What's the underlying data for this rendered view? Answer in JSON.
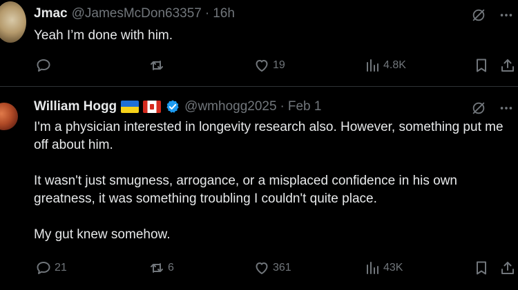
{
  "tweets": [
    {
      "name": "Jmac",
      "handle": "@JamesMcDon63357",
      "separator": "·",
      "time": "16h",
      "text": [
        "Yeah I’m done with him."
      ],
      "replies": "",
      "reposts": "",
      "likes": "19",
      "views": "4.8K"
    },
    {
      "name": "William Hogg",
      "flags": [
        "flag-ukraine",
        "flag-canada"
      ],
      "verified": true,
      "handle": "@wmhogg2025",
      "separator": "·",
      "time": "Feb 1",
      "text": [
        "I'm a physician interested in longevity research also.  However, something put me off about him.",
        "It wasn't just smugness, arrogance, or a misplaced confidence in his own greatness, it was something troubling I couldn't quite place.",
        "My gut knew somehow."
      ],
      "replies": "21",
      "reposts": "6",
      "likes": "361",
      "views": "43K"
    }
  ],
  "icons": [
    "grok-icon",
    "more-icon",
    "reply-icon",
    "repost-icon",
    "like-icon",
    "views-icon",
    "bookmark-icon",
    "share-icon"
  ],
  "colors": {
    "background": "#000000",
    "text": "#e7e9ea",
    "secondary": "#71767b",
    "divider": "#2f3336",
    "verified": "#1d9bf0"
  }
}
